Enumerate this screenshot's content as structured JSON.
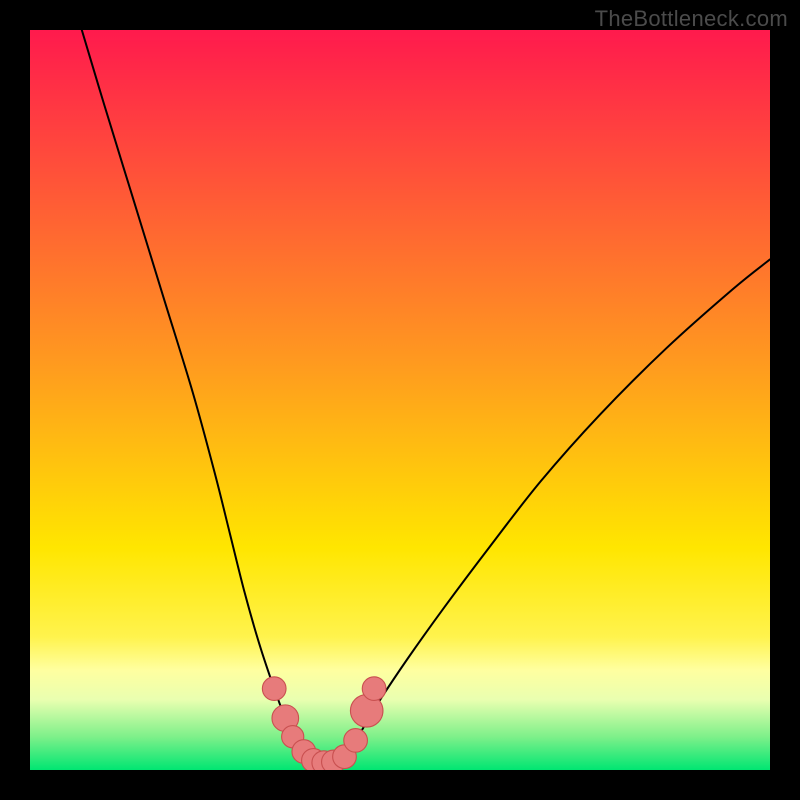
{
  "watermark": "TheBottleneck.com",
  "colors": {
    "frame": "#000000",
    "gradient_stops": [
      {
        "offset": 0.0,
        "color": "#ff1a4d"
      },
      {
        "offset": 0.45,
        "color": "#ff9a1f"
      },
      {
        "offset": 0.7,
        "color": "#ffe600"
      },
      {
        "offset": 0.82,
        "color": "#fff34d"
      },
      {
        "offset": 0.865,
        "color": "#ffffa0"
      },
      {
        "offset": 0.905,
        "color": "#e9ffb0"
      },
      {
        "offset": 0.955,
        "color": "#7ef08a"
      },
      {
        "offset": 1.0,
        "color": "#00e672"
      }
    ],
    "curve_stroke": "#000000",
    "marker_fill": "#e77b7b",
    "marker_stroke": "#c95050"
  },
  "chart_data": {
    "type": "line",
    "title": "",
    "xlabel": "",
    "ylabel": "",
    "xlim": [
      0,
      100
    ],
    "ylim": [
      0,
      100
    ],
    "series": [
      {
        "name": "left-curve",
        "x": [
          7,
          10,
          14,
          18,
          22,
          25,
          27,
          29,
          31,
          33,
          34.5,
          36,
          37.5
        ],
        "y": [
          100,
          90,
          77,
          64,
          51,
          40,
          32,
          24,
          17,
          11,
          7,
          3.5,
          1.5
        ]
      },
      {
        "name": "valley",
        "x": [
          37.5,
          39,
          40.5,
          42
        ],
        "y": [
          1.5,
          1.0,
          1.0,
          1.5
        ]
      },
      {
        "name": "right-curve",
        "x": [
          42,
          44,
          47,
          51,
          56,
          62,
          69,
          77,
          86,
          95,
          100
        ],
        "y": [
          1.5,
          4,
          9,
          15,
          22,
          30,
          39,
          48,
          57,
          65,
          69
        ]
      }
    ],
    "markers": [
      {
        "x": 33.0,
        "y": 11.0,
        "r": 1.6
      },
      {
        "x": 34.5,
        "y": 7.0,
        "r": 1.8
      },
      {
        "x": 35.5,
        "y": 4.5,
        "r": 1.5
      },
      {
        "x": 37.0,
        "y": 2.5,
        "r": 1.6
      },
      {
        "x": 38.3,
        "y": 1.3,
        "r": 1.6
      },
      {
        "x": 39.7,
        "y": 1.0,
        "r": 1.6
      },
      {
        "x": 41.0,
        "y": 1.1,
        "r": 1.6
      },
      {
        "x": 42.5,
        "y": 1.8,
        "r": 1.6
      },
      {
        "x": 44.0,
        "y": 4.0,
        "r": 1.6
      },
      {
        "x": 45.5,
        "y": 8.0,
        "r": 2.2
      },
      {
        "x": 46.5,
        "y": 11.0,
        "r": 1.6
      }
    ]
  }
}
